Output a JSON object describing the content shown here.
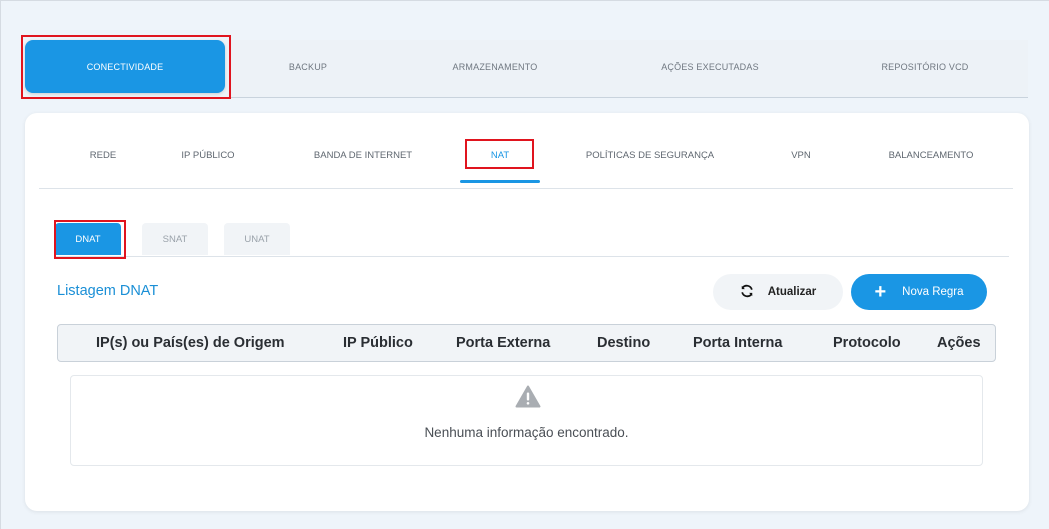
{
  "top_tabs": [
    {
      "label": "CONECTIVIDADE",
      "active": true
    },
    {
      "label": "BACKUP"
    },
    {
      "label": "ARMAZENAMENTO"
    },
    {
      "label": "AÇÕES EXECUTADAS"
    },
    {
      "label": "REPOSITÓRIO VCD"
    }
  ],
  "sub_tabs": [
    {
      "label": "REDE"
    },
    {
      "label": "IP PÚBLICO"
    },
    {
      "label": "BANDA DE INTERNET"
    },
    {
      "label": "NAT",
      "active": true
    },
    {
      "label": "POLÍTICAS DE SEGURANÇA"
    },
    {
      "label": "VPN"
    },
    {
      "label": "BALANCEAMENTO"
    }
  ],
  "nat_tabs": [
    {
      "label": "DNAT",
      "active": true
    },
    {
      "label": "SNAT"
    },
    {
      "label": "UNAT"
    }
  ],
  "section": {
    "title": "Listagem DNAT",
    "refresh_label": "Atualizar",
    "new_rule_label": "Nova Regra"
  },
  "table": {
    "columns": [
      "IP(s) ou País(es) de Origem",
      "IP Público",
      "Porta Externa",
      "Destino",
      "Porta Interna",
      "Protocolo",
      "Ações"
    ],
    "empty_message": "Nenhuma informação encontrado."
  },
  "colors": {
    "accent": "#1a96e4",
    "highlight": "#e0141e"
  }
}
